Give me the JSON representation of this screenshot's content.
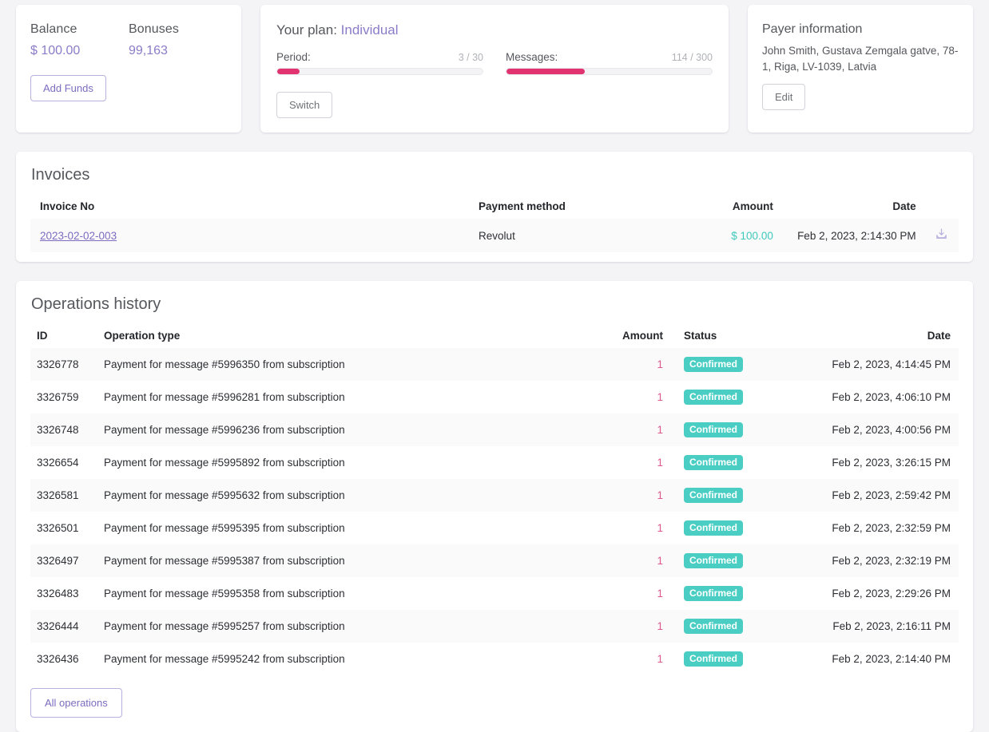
{
  "balance_card": {
    "balance_label": "Balance",
    "balance_value": "$ 100.00",
    "bonuses_label": "Bonuses",
    "bonuses_value": "99,163",
    "add_funds_label": "Add Funds"
  },
  "plan_card": {
    "title_prefix": "Your plan:",
    "plan_name": "Individual",
    "period_label": "Period:",
    "period_fraction": "3 / 30",
    "period_percent": 11,
    "messages_label": "Messages:",
    "messages_fraction": "114 / 300",
    "messages_percent": 38,
    "switch_label": "Switch"
  },
  "payer_card": {
    "title": "Payer information",
    "address": "John Smith, Gustava Zemgala gatve, 78-1, Riga, LV-1039, Latvia",
    "edit_label": "Edit"
  },
  "invoices": {
    "title": "Invoices",
    "columns": {
      "invoice_no": "Invoice No",
      "payment_method": "Payment method",
      "amount": "Amount",
      "date": "Date"
    },
    "download_icon": "download-icon",
    "rows": [
      {
        "invoice_no": "2023-02-02-003",
        "payment_method": "Revolut",
        "amount": "$ 100.00",
        "date": "Feb 2, 2023, 2:14:30 PM"
      }
    ]
  },
  "operations": {
    "title": "Operations history",
    "columns": {
      "id": "ID",
      "type": "Operation type",
      "amount": "Amount",
      "status": "Status",
      "date": "Date"
    },
    "all_operations_label": "All operations",
    "rows": [
      {
        "id": "3326778",
        "type": "Payment for message #5996350 from subscription",
        "amount": "1",
        "status": "Confirmed",
        "date": "Feb 2, 2023, 4:14:45 PM"
      },
      {
        "id": "3326759",
        "type": "Payment for message #5996281 from subscription",
        "amount": "1",
        "status": "Confirmed",
        "date": "Feb 2, 2023, 4:06:10 PM"
      },
      {
        "id": "3326748",
        "type": "Payment for message #5996236 from subscription",
        "amount": "1",
        "status": "Confirmed",
        "date": "Feb 2, 2023, 4:00:56 PM"
      },
      {
        "id": "3326654",
        "type": "Payment for message #5995892 from subscription",
        "amount": "1",
        "status": "Confirmed",
        "date": "Feb 2, 2023, 3:26:15 PM"
      },
      {
        "id": "3326581",
        "type": "Payment for message #5995632 from subscription",
        "amount": "1",
        "status": "Confirmed",
        "date": "Feb 2, 2023, 2:59:42 PM"
      },
      {
        "id": "3326501",
        "type": "Payment for message #5995395 from subscription",
        "amount": "1",
        "status": "Confirmed",
        "date": "Feb 2, 2023, 2:32:59 PM"
      },
      {
        "id": "3326497",
        "type": "Payment for message #5995387 from subscription",
        "amount": "1",
        "status": "Confirmed",
        "date": "Feb 2, 2023, 2:32:19 PM"
      },
      {
        "id": "3326483",
        "type": "Payment for message #5995358 from subscription",
        "amount": "1",
        "status": "Confirmed",
        "date": "Feb 2, 2023, 2:29:26 PM"
      },
      {
        "id": "3326444",
        "type": "Payment for message #5995257 from subscription",
        "amount": "1",
        "status": "Confirmed",
        "date": "Feb 2, 2023, 2:16:11 PM"
      },
      {
        "id": "3326436",
        "type": "Payment for message #5995242 from subscription",
        "amount": "1",
        "status": "Confirmed",
        "date": "Feb 2, 2023, 2:14:40 PM"
      }
    ]
  },
  "colors": {
    "purple": "#8b7cc8",
    "pink": "#e0336f",
    "teal": "#4acec4",
    "amount_pink": "#e0568e",
    "amount_teal": "#3ec9bd",
    "page_bg": "#f4f4f7"
  }
}
